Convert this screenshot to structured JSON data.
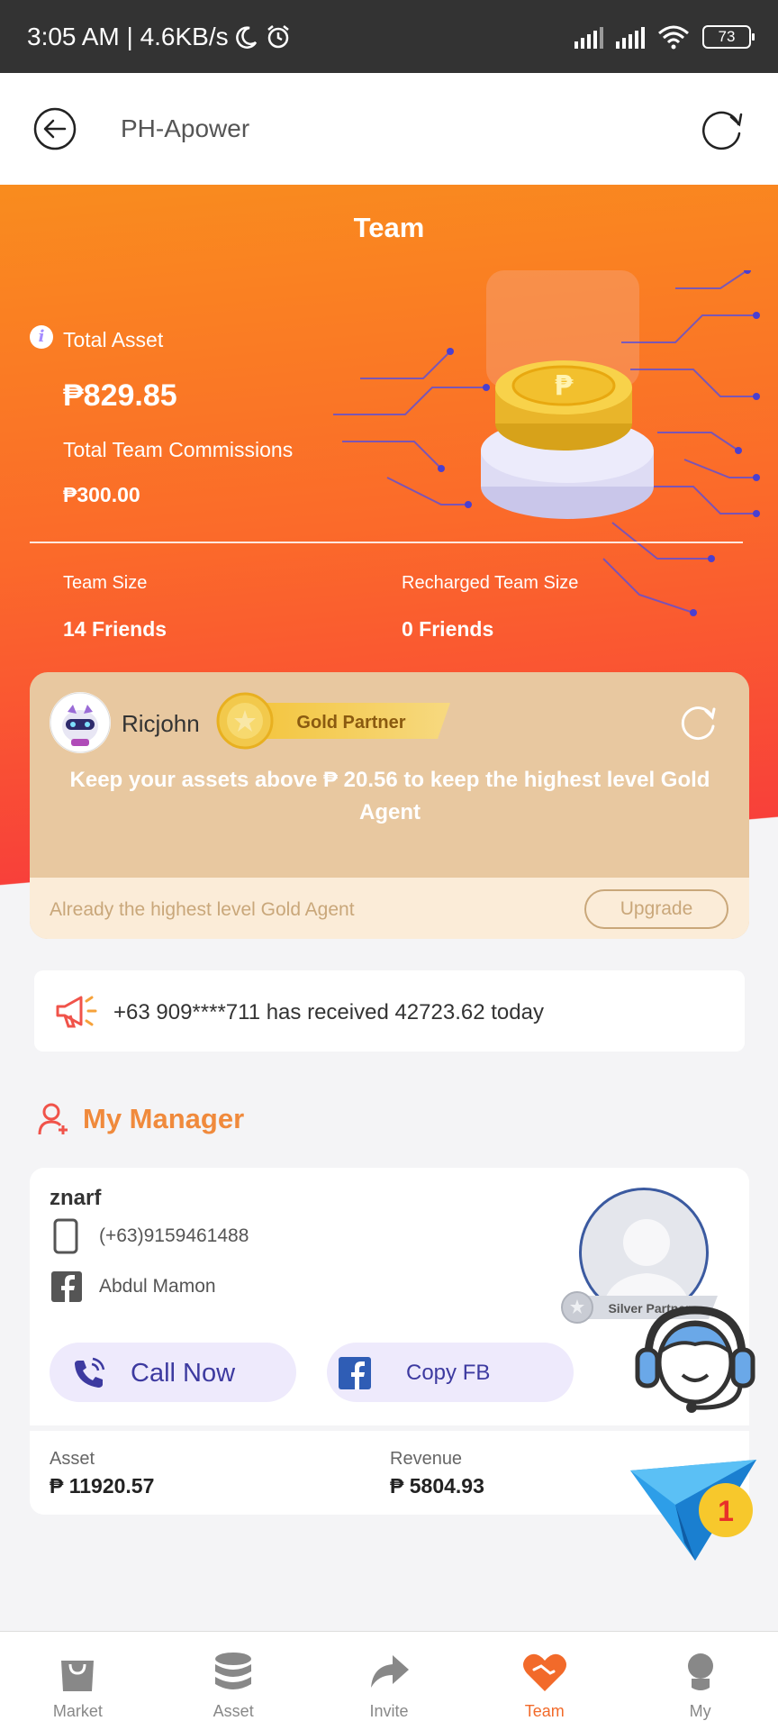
{
  "status_bar": {
    "time_speed": "3:05 AM | 4.6KB/s",
    "battery": "73"
  },
  "header": {
    "title": "PH-Apower"
  },
  "hero": {
    "title": "Team",
    "total_asset_label": "Total Asset",
    "total_asset_value": "₱829.85",
    "commissions_label": "Total Team Commissions",
    "commissions_value": "₱300.00",
    "team_size_label": "Team Size",
    "team_size_value": "14 Friends",
    "recharged_label": "Recharged Team Size",
    "recharged_value": "0 Friends"
  },
  "partner": {
    "name": "Ricjohn",
    "badge": "Gold Partner",
    "message": "Keep your assets above ₱ 20.56 to keep the highest level Gold Agent",
    "status": "Already the highest level Gold Agent",
    "upgrade_label": "Upgrade"
  },
  "announcement": {
    "text": "+63 909****711 has received 42723.62 today"
  },
  "manager": {
    "section_title": "My Manager",
    "name": "znarf",
    "phone": "(+63)9159461488",
    "facebook": "Abdul Mamon",
    "badge": "Silver Partner",
    "call_label": "Call Now",
    "copy_fb_label": "Copy FB",
    "asset_label": "Asset",
    "asset_value": "₱ 11920.57",
    "revenue_label": "Revenue",
    "revenue_value": "₱ 5804.93"
  },
  "plane_badge": "1",
  "nav": [
    {
      "label": "Market",
      "icon": "bag-icon"
    },
    {
      "label": "Asset",
      "icon": "database-icon"
    },
    {
      "label": "Invite",
      "icon": "share-icon"
    },
    {
      "label": "Team",
      "icon": "heart-handshake-icon"
    },
    {
      "label": "My",
      "icon": "user-icon"
    }
  ],
  "colors": {
    "hero_top": "#f98c1e",
    "hero_bottom": "#f8403a",
    "accent": "#f26a2a",
    "manager_title": "#f08a3c",
    "button_text": "#3d3aa0"
  }
}
